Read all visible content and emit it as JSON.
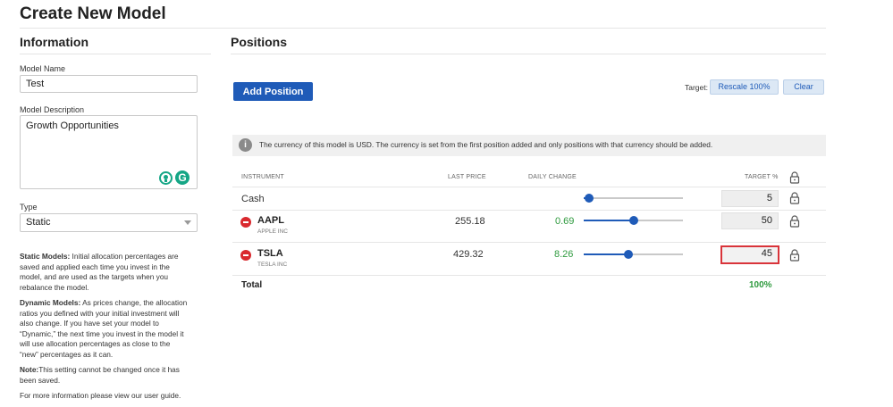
{
  "page": {
    "title": "Create New Model"
  },
  "information": {
    "heading": "Information",
    "model_name_label": "Model Name",
    "model_name_value": "Test",
    "model_description_label": "Model Description",
    "model_description_value": "Growth Opportunities",
    "type_label": "Type",
    "type_value": "Static",
    "help": {
      "static_title": "Static Models:",
      "static_text": " Initial allocation percentages are saved and applied each time you invest in the model, and are used as the targets when you rebalance the model.",
      "dynamic_title": "Dynamic Models:",
      "dynamic_text": " As prices change, the allocation ratios you defined with your initial investment will also change. If you have set your model to “Dynamic,” the next time you invest in the model it will use allocation percentages as close to the “new” percentages as it can.",
      "note_title": "Note:",
      "note_text": "This setting cannot be changed once it has been saved.",
      "guide_text": "For more information please view our user guide."
    }
  },
  "positions": {
    "heading": "Positions",
    "add_position_label": "Add Position",
    "target_label": "Target:",
    "rescale_label": "Rescale 100%",
    "clear_label": "Clear",
    "info_text": "The currency of this model is USD. The currency is set from the first position added and only positions with that currency should be added.",
    "columns": {
      "instrument": "INSTRUMENT",
      "last_price": "LAST PRICE",
      "daily_change": "DAILY CHANGE",
      "target": "TARGET %"
    },
    "cash": {
      "label": "Cash",
      "target": "5",
      "slider_fraction": 0.05
    },
    "rows": [
      {
        "symbol": "AAPL",
        "name": "APPLE INC",
        "last_price": "255.18",
        "daily_change": "0.69",
        "target": "50",
        "slider_fraction": 0.5
      },
      {
        "symbol": "TSLA",
        "name": "TESLA INC",
        "last_price": "429.32",
        "daily_change": "8.26",
        "target": "45",
        "slider_fraction": 0.45
      }
    ],
    "total_label": "Total",
    "total_value": "100%"
  },
  "colors": {
    "primary": "#1f5bb8",
    "positive": "#2e9a3e",
    "remove": "#d9292e",
    "highlight": "#d9343a"
  },
  "icons": [
    "info-icon",
    "remove-icon",
    "lock-icon",
    "grammarly-icon",
    "idea-icon",
    "chevron-down-icon"
  ]
}
